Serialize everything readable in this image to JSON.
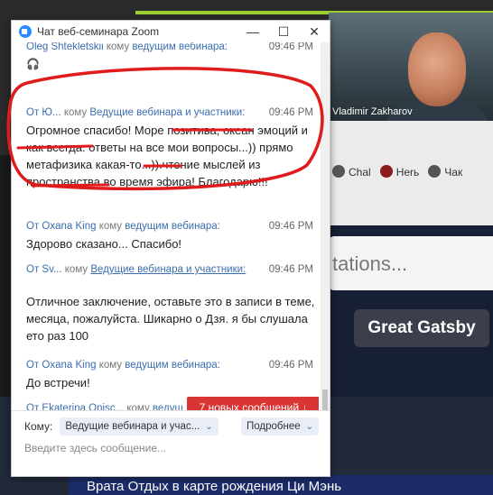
{
  "window": {
    "title": "Чат веб-семинара Zoom",
    "minimize": "—",
    "maximize": "☐",
    "close": "✕"
  },
  "background": {
    "video_name": "Vladimir Zakharov",
    "tabs": [
      "Chal",
      "Herь",
      "Чак"
    ],
    "input_text": "tations...",
    "button": "Great Gatsby",
    "bottom_text": "Врата Отдых в карте рождения Ци Мэнь"
  },
  "messages": [
    {
      "sender": "Oleg Shtekletskii",
      "to": "кому",
      "target": "ведущим вебинара:",
      "time": "09:46 PM",
      "body": "🎧",
      "target_underline": false
    },
    {
      "sender": "От Ю...",
      "to": "кому",
      "target": "Ведущие вебинара и участники:",
      "time": "09:46 PM",
      "body": "Огромное спасибо! Море позитива, океан эмоций и как всегда. ответы на все мои вопросы...)) прямо метафизика какая-то...)).чтение мыслей из пространства во время эфира! Благодарю!!!",
      "target_underline": false
    },
    {
      "sender": "От Oxana King",
      "to": "кому",
      "target": "ведущим вебинара:",
      "time": "09:46 PM",
      "body": "Здорово сказано... Спасибо!",
      "target_underline": false
    },
    {
      "sender": "От Sv...",
      "to": "кому",
      "target": "Ведущие вебинара и участники:",
      "time": "09:46 PM",
      "body": "Отличное заключение, оставьте это в записи в теме, месяца, пожалуйста. Шикарно о Дзя. я бы слушала ето раз 100",
      "target_underline": true
    },
    {
      "sender": "От Oxana King",
      "to": "кому",
      "target": "ведущим вебинара:",
      "time": "09:46 PM",
      "body": "До встречи!",
      "target_underline": false
    },
    {
      "sender": "От Ekaterina Onisc...",
      "to": "кому",
      "target": "ведущ",
      "time": "",
      "body": "",
      "target_underline": false
    }
  ],
  "new_messages_badge": "7 новых сообщений ↓",
  "composer": {
    "to_label": "Кому:",
    "to_value": "Ведущие вебинара и учас...",
    "more": "Подробнее",
    "placeholder": "Введите здесь сообщение..."
  },
  "colors": {
    "accent": "#3b6eb0",
    "badge": "#d93535",
    "annotation": "#e01b1b"
  }
}
